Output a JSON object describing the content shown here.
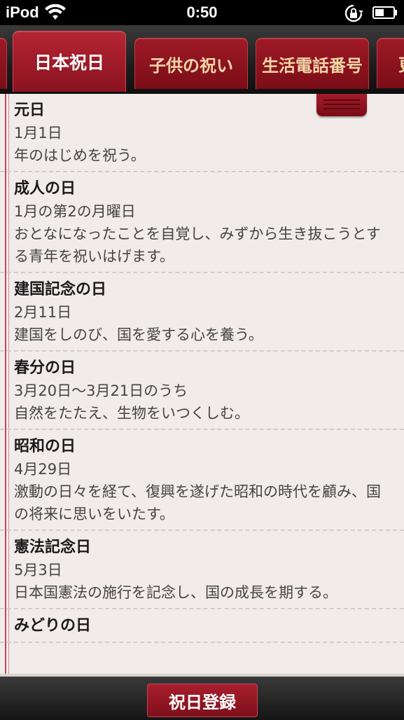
{
  "status_bar": {
    "carrier": "iPod",
    "time": "0:50"
  },
  "tabs": [
    {
      "label": ""
    },
    {
      "label": "日本祝日"
    },
    {
      "label": "子供の祝い"
    },
    {
      "label": "生活電話番号"
    },
    {
      "label": "更"
    }
  ],
  "holidays": [
    {
      "name": "元日",
      "date": "1月1日",
      "desc": "年のはじめを祝う。"
    },
    {
      "name": "成人の日",
      "date": "1月の第2の月曜日",
      "desc": "おとなになったことを自覚し、みずから生き抜こうとする青年を祝いはげます。"
    },
    {
      "name": "建国記念の日",
      "date": "2月11日",
      "desc": "建国をしのび、国を愛する心を養う。"
    },
    {
      "name": "春分の日",
      "date": "3月20日～3月21日のうち",
      "desc": "自然をたたえ、生物をいつくしむ。"
    },
    {
      "name": "昭和の日",
      "date": "4月29日",
      "desc": "激動の日々を経て、復興を遂げた昭和の時代を顧み、国の将来に思いをいたす。"
    },
    {
      "name": "憲法記念日",
      "date": "5月3日",
      "desc": "日本国憲法の施行を記念し、国の成長を期する。"
    },
    {
      "name": "みどりの日",
      "date": "",
      "desc": ""
    }
  ],
  "toolbar": {
    "register_label": "祝日登録"
  }
}
